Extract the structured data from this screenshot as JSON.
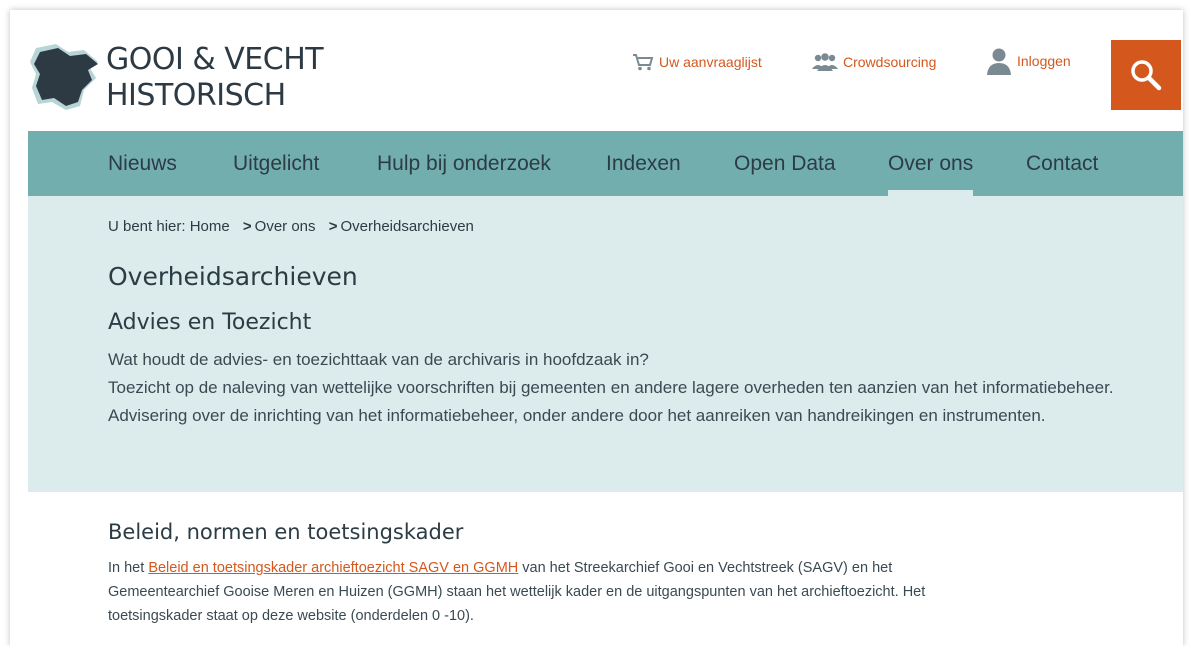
{
  "logo": {
    "line1": "GOOI & VECHT",
    "line2": "HISTORISCH"
  },
  "top_links": {
    "aanvraaglijst": "Uw aanvraaglijst",
    "crowdsourcing": "Crowdsourcing",
    "inloggen": "Inloggen"
  },
  "nav": {
    "items": [
      "Nieuws",
      "Uitgelicht",
      "Hulp bij onderzoek",
      "Indexen",
      "Open Data",
      "Over ons",
      "Contact"
    ],
    "active": "Over ons"
  },
  "breadcrumb": {
    "prefix": "U bent hier:",
    "items": [
      "Home",
      "Over ons",
      "Overheidsarchieven"
    ],
    "separator": ">"
  },
  "page_title": "Overheidsarchieven",
  "section1": {
    "heading": "Advies en Toezicht",
    "question": "Wat houdt de advies- en toezichttaak van de archivaris in hoofdzaak in?",
    "answer": "Toezicht op de naleving van wettelijke voorschriften bij gemeenten en andere lagere overheden ten aanzien van het informatiebeheer. Advisering over de inrichting van het informatiebeheer, onder andere door het aanreiken van handreikingen en instrumenten."
  },
  "section2": {
    "heading": "Beleid, normen en toetsingskader",
    "text_before": "In het ",
    "link": "Beleid en toetsingskader archieftoezicht SAGV en GGMH",
    "text_after": " van het Streekarchief Gooi en Vechtstreek (SAGV) en het Gemeentearchief Gooise Meren en Huizen (GGMH) staan het wettelijk kader en de uitgangspunten van het archieftoezicht. Het toetsingskader staat op deze website (onderdelen 0 -10)."
  },
  "colors": {
    "accent": "#d4581e",
    "nav_bg": "#72aeae",
    "intro_bg": "#dcecec",
    "text": "#2c3c44"
  }
}
